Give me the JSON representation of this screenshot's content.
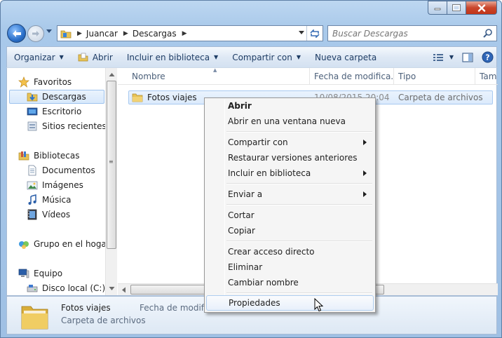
{
  "window": {
    "breadcrumb": [
      "Juancar",
      "Descargas"
    ],
    "search_placeholder": "Buscar Descargas"
  },
  "toolbar": {
    "organize": "Organizar",
    "open": "Abrir",
    "include": "Incluir en biblioteca",
    "share": "Compartir con",
    "new_folder": "Nueva carpeta"
  },
  "sidebar": {
    "favorites": "Favoritos",
    "downloads": "Descargas",
    "desktop": "Escritorio",
    "recent": "Sitios recientes",
    "libraries": "Bibliotecas",
    "documents": "Documentos",
    "images": "Imágenes",
    "music": "Música",
    "videos": "Vídeos",
    "homegroup": "Grupo en el hogar",
    "computer": "Equipo",
    "local_disk": "Disco local (C:)"
  },
  "columns": {
    "name": "Nombre",
    "date": "Fecha de modifica...",
    "type": "Tipo",
    "size": "Tam"
  },
  "file": {
    "name": "Fotos viajes",
    "date": "10/08/2015 20:04",
    "type": "Carpeta de archivos"
  },
  "details": {
    "name": "Fotos viajes",
    "type": "Carpeta de archivos",
    "date_label": "Fecha de modificación"
  },
  "context_menu": {
    "open": "Abrir",
    "open_new_window": "Abrir en una ventana nueva",
    "share": "Compartir con",
    "restore": "Restaurar versiones anteriores",
    "include": "Incluir en biblioteca",
    "send_to": "Enviar a",
    "cut": "Cortar",
    "copy": "Copiar",
    "create_shortcut": "Crear acceso directo",
    "delete": "Eliminar",
    "rename": "Cambiar nombre",
    "properties": "Propiedades"
  },
  "colors": {
    "selection": "#dbeafc",
    "accent": "#2a6fc9",
    "close_button": "#c9462c"
  }
}
